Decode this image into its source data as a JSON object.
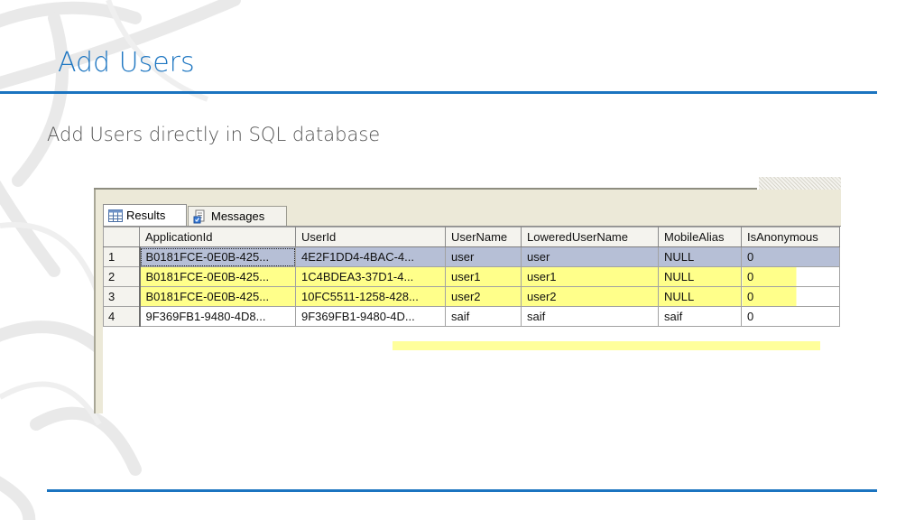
{
  "slide": {
    "title": "Add Users",
    "subtitle": "Add Users directly in SQL database",
    "accent_color": "#1b74c0"
  },
  "ssms": {
    "tabs": [
      {
        "label": "Results",
        "icon": "grid-icon",
        "active": true
      },
      {
        "label": "Messages",
        "icon": "messages-icon",
        "active": false
      }
    ],
    "columns": [
      "ApplicationId",
      "UserId",
      "UserName",
      "LoweredUserName",
      "MobileAlias",
      "IsAnonymous"
    ],
    "rows": [
      {
        "num": "1",
        "cells": [
          "B0181FCE-0E0B-425...",
          "4E2F1DD4-4BAC-4...",
          "user",
          "user",
          "NULL",
          "0"
        ]
      },
      {
        "num": "2",
        "cells": [
          "B0181FCE-0E0B-425...",
          "1C4BDEA3-37D1-4...",
          "user1",
          "user1",
          "NULL",
          "0"
        ]
      },
      {
        "num": "3",
        "cells": [
          "B0181FCE-0E0B-425...",
          "10FC5511-1258-428...",
          "user2",
          "user2",
          "NULL",
          "0"
        ]
      },
      {
        "num": "4",
        "cells": [
          "9F369FB1-9480-4D8...",
          "9F369FB1-9480-4D...",
          "saif",
          "saif",
          "saif",
          "0"
        ]
      }
    ],
    "selection_color": "#b6bfd6",
    "highlight_color": "#ffff8a"
  }
}
